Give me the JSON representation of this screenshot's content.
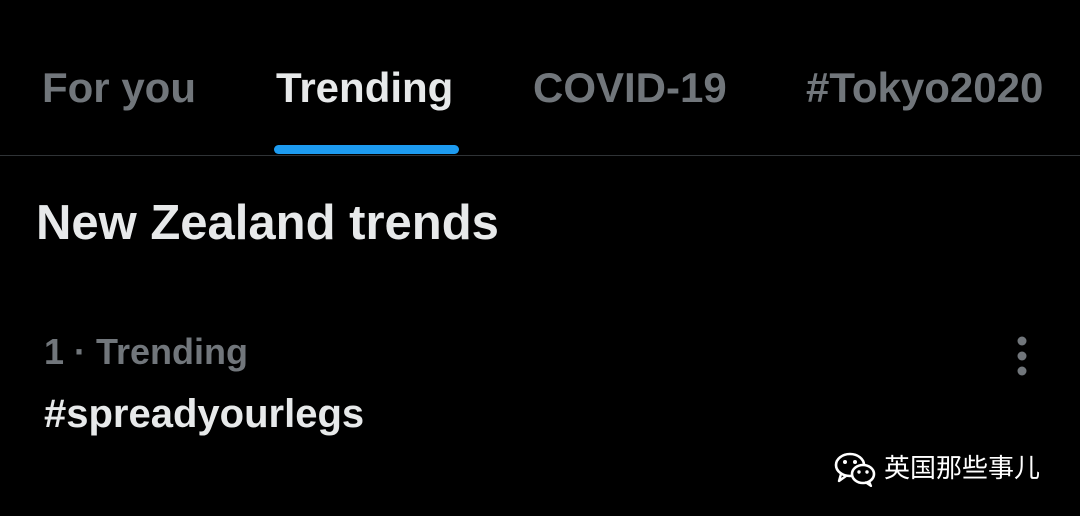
{
  "tabs": [
    {
      "label": "For you",
      "active": false
    },
    {
      "label": "Trending",
      "active": true
    },
    {
      "label": "COVID-19",
      "active": false
    },
    {
      "label": "#Tokyo2020",
      "active": false
    }
  ],
  "section": {
    "title": "New Zealand trends"
  },
  "trends": [
    {
      "meta": "1 · Trending",
      "name": "#spreadyourlegs",
      "more_icon": "more-vertical-icon"
    }
  ],
  "watermark": {
    "text": "英国那些事儿",
    "icon": "wechat-icon"
  },
  "colors": {
    "background": "#000000",
    "text_primary": "#e7e9ea",
    "text_secondary": "#71767b",
    "accent": "#1d9bf0",
    "divider": "#2f3336"
  }
}
